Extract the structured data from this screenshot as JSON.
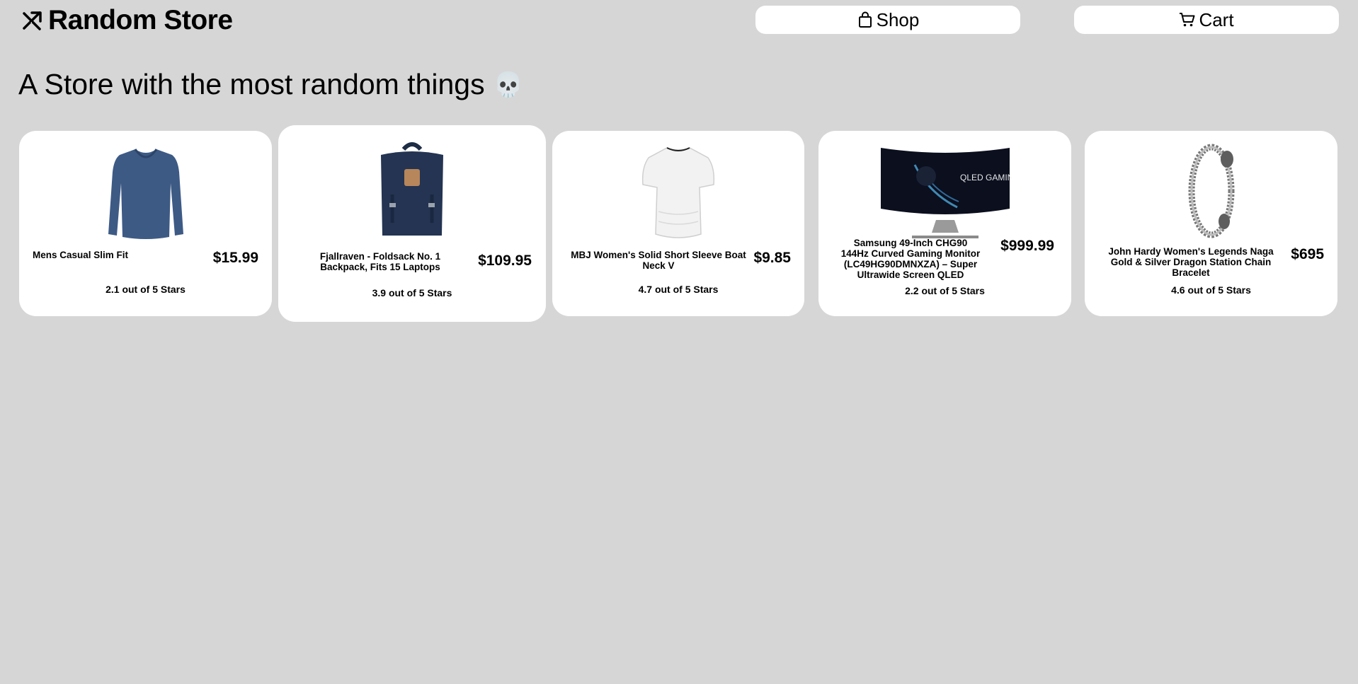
{
  "header": {
    "brand": "Random Store",
    "nav": {
      "shop_label": "Shop",
      "cart_label": "Cart"
    }
  },
  "tagline": "A Store with the most random things",
  "tagline_emoji": "💀",
  "products": [
    {
      "title": "Mens Casual Slim Fit",
      "price": "$15.99",
      "rating": "2.1 out of 5 Stars"
    },
    {
      "title": "Fjallraven - Foldsack No. 1 Backpack, Fits 15 Laptops",
      "price": "$109.95",
      "rating": "3.9 out of 5 Stars"
    },
    {
      "title": "MBJ Women's Solid Short Sleeve Boat Neck V",
      "price": "$9.85",
      "rating": "4.7 out of 5 Stars"
    },
    {
      "title": "Samsung 49-Inch CHG90 144Hz Curved Gaming Monitor (LC49HG90DMNXZA) – Super Ultrawide Screen QLED",
      "price": "$999.99",
      "rating": "2.2 out of 5 Stars",
      "screen_text": "QLED GAMING MONITOR"
    },
    {
      "title": "John Hardy Women's Legends Naga Gold & Silver Dragon Station Chain Bracelet",
      "price": "$695",
      "rating": "4.6 out of 5 Stars"
    }
  ]
}
